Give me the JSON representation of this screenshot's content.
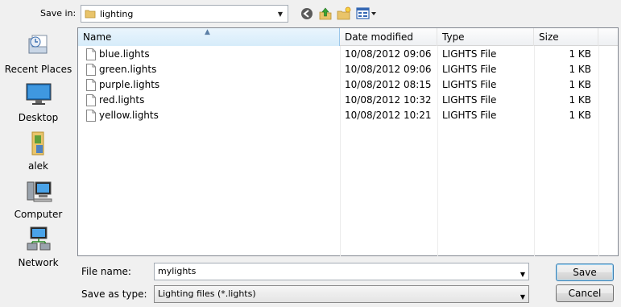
{
  "location": {
    "label": "Save in:",
    "current_folder": "lighting",
    "folder_icon": "folder-icon"
  },
  "toolbar": {
    "back_icon": "back-icon",
    "up_icon": "up-folder-icon",
    "new_folder_icon": "new-folder-icon",
    "views_icon": "view-menu-icon"
  },
  "places": [
    {
      "label": "Recent Places",
      "icon": "recent-places-icon"
    },
    {
      "label": "Desktop",
      "icon": "desktop-icon"
    },
    {
      "label": "alek",
      "icon": "user-folder-icon"
    },
    {
      "label": "Computer",
      "icon": "computer-icon"
    },
    {
      "label": "Network",
      "icon": "network-icon"
    }
  ],
  "columns": [
    "Name",
    "Date modified",
    "Type",
    "Size"
  ],
  "files": [
    {
      "name": "blue.lights",
      "date": "10/08/2012 09:06",
      "type": "LIGHTS File",
      "size": "1 KB"
    },
    {
      "name": "green.lights",
      "date": "10/08/2012 09:06",
      "type": "LIGHTS File",
      "size": "1 KB"
    },
    {
      "name": "purple.lights",
      "date": "10/08/2012 08:15",
      "type": "LIGHTS File",
      "size": "1 KB"
    },
    {
      "name": "red.lights",
      "date": "10/08/2012 10:32",
      "type": "LIGHTS File",
      "size": "1 KB"
    },
    {
      "name": "yellow.lights",
      "date": "10/08/2012 10:21",
      "type": "LIGHTS File",
      "size": "1 KB"
    }
  ],
  "bottom": {
    "filename_label": "File name:",
    "filename_value": "mylights",
    "filetype_label": "Save as type:",
    "filetype_value": "Lighting files (*.lights)",
    "save_label": "Save",
    "cancel_label": "Cancel"
  }
}
